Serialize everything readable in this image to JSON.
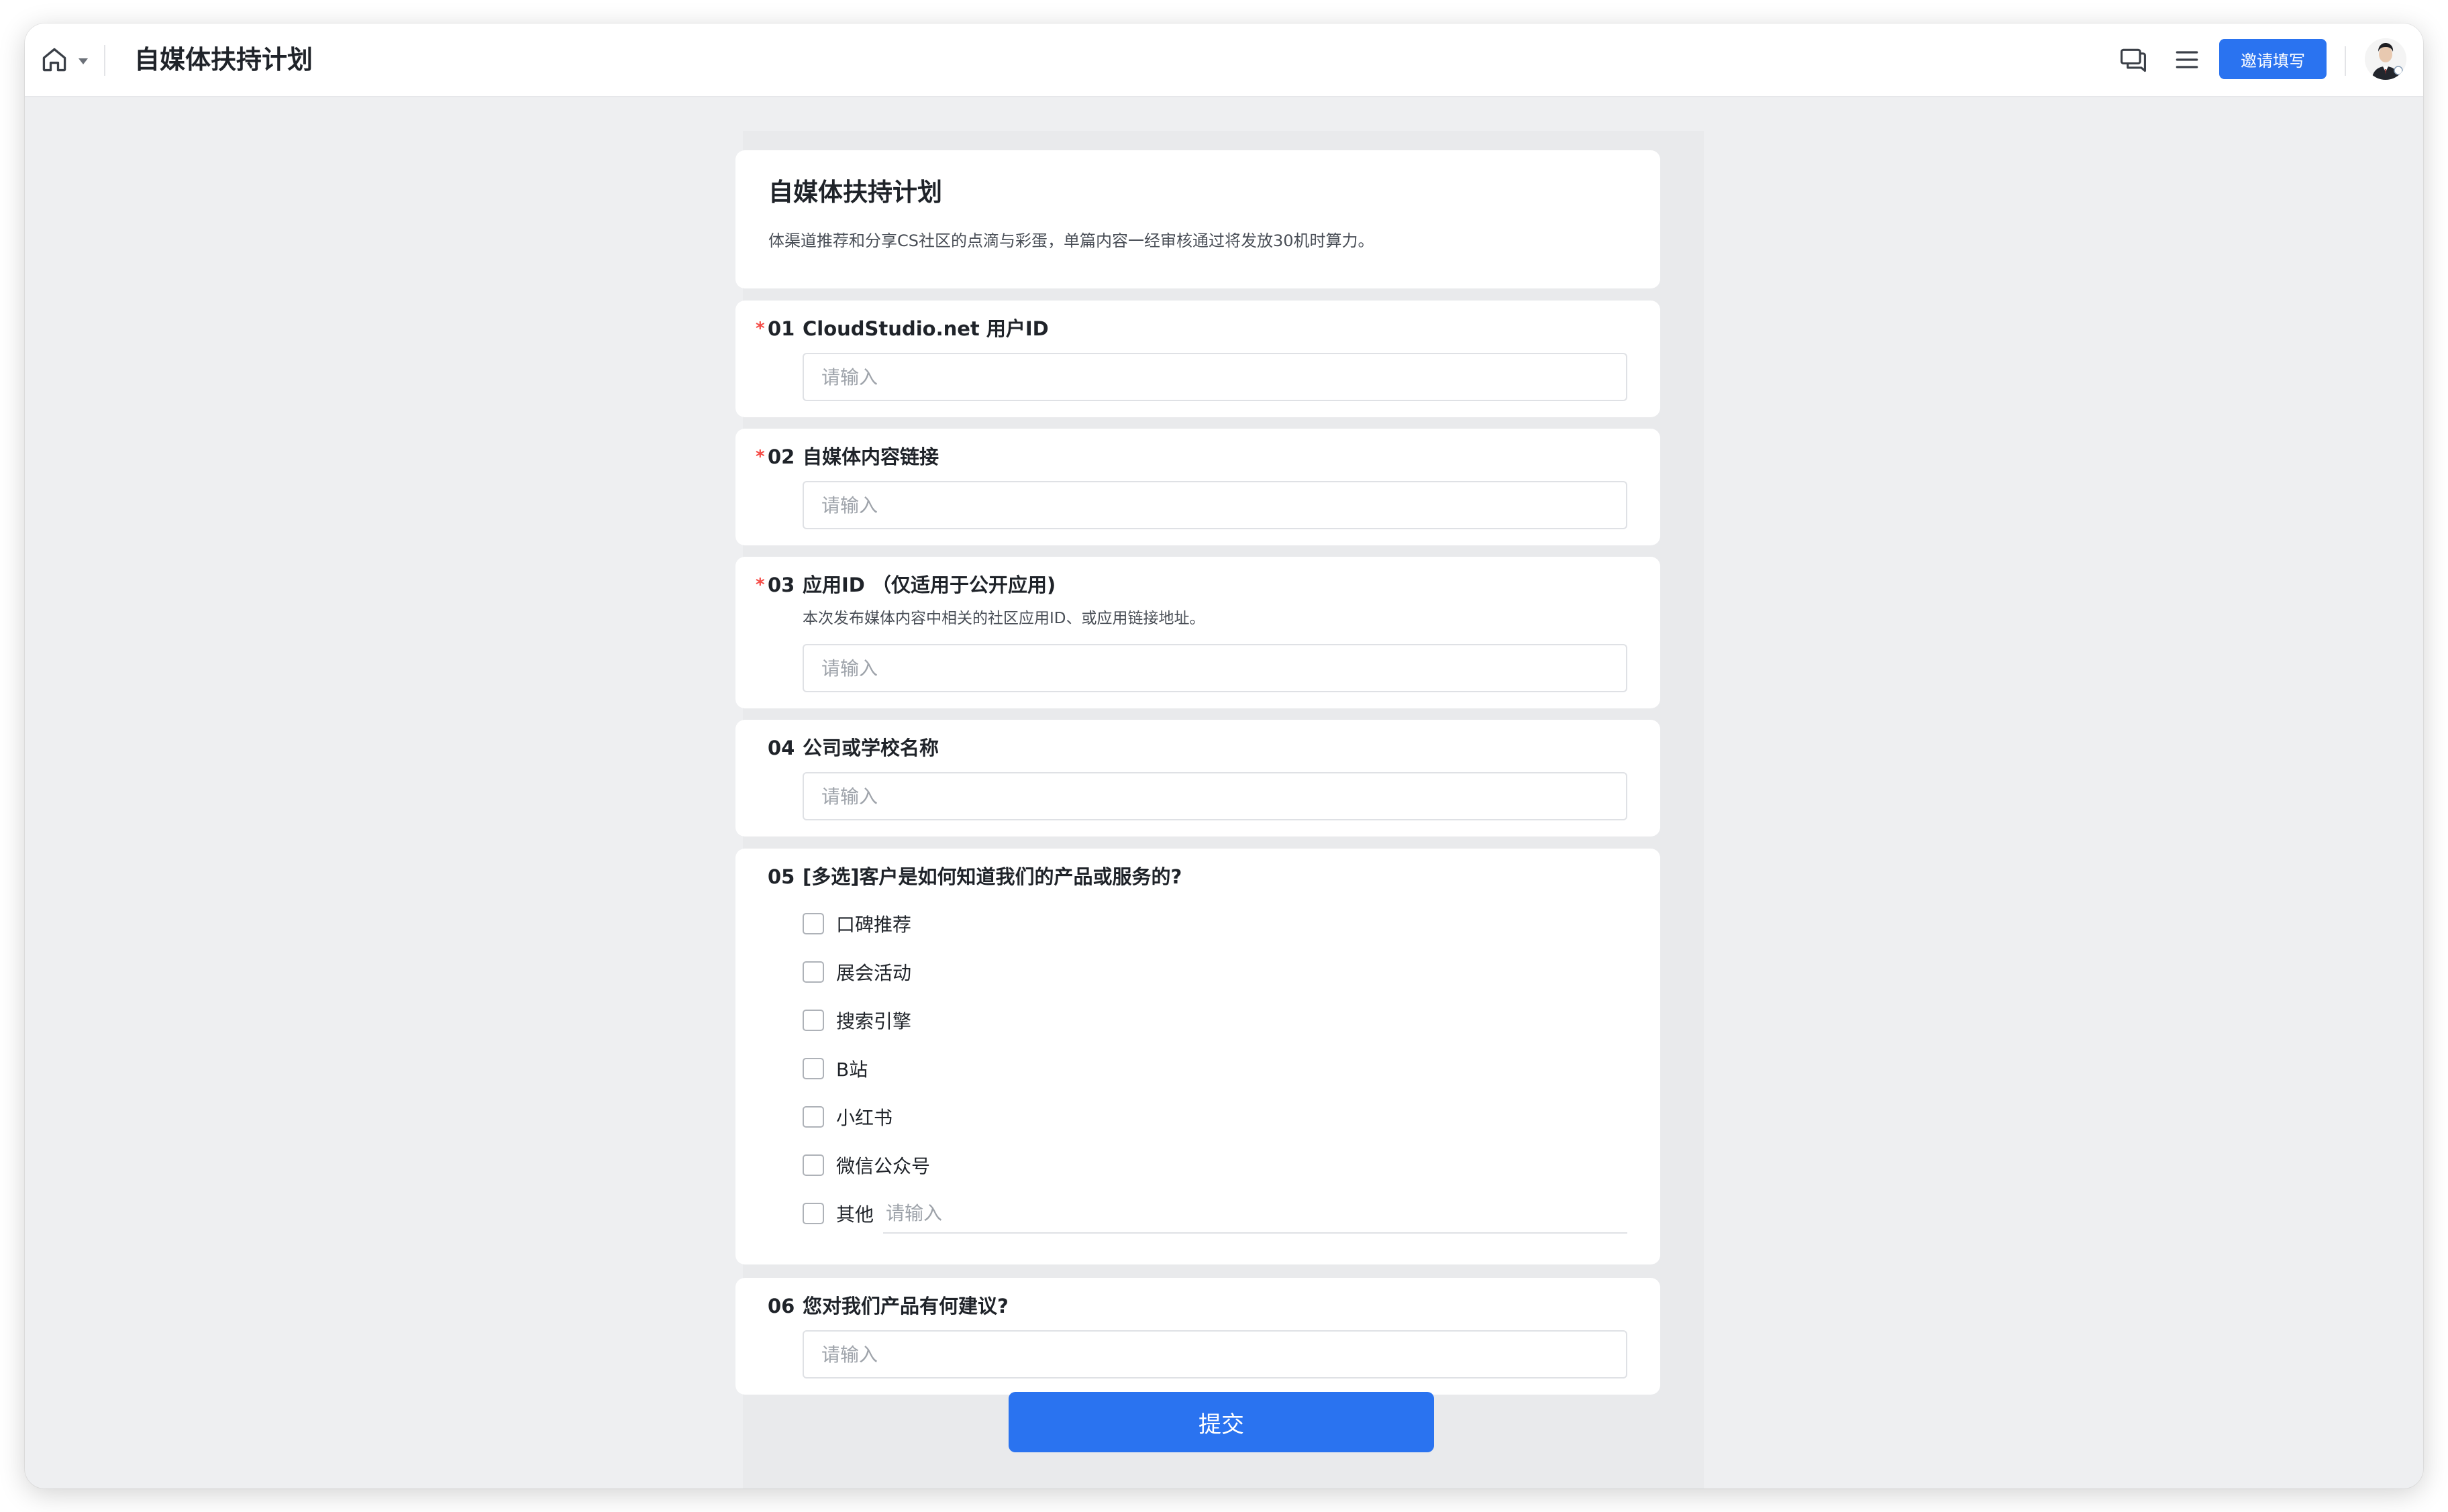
{
  "header": {
    "title": "自媒体扶持计划",
    "invite_label": "邀请填写",
    "icons": {
      "home": "home-icon",
      "chat": "chat-windows-icon",
      "menu": "menu-icon"
    },
    "accent": "#2a73f0"
  },
  "intro": {
    "title": "自媒体扶持计划",
    "description": "体渠道推荐和分享CS社区的点滴与彩蛋，单篇内容一经审核通过将发放30机时算力。"
  },
  "questions": [
    {
      "number": "01",
      "required": true,
      "label": "CloudStudio.net 用户ID",
      "placeholder": "请输入",
      "value": ""
    },
    {
      "number": "02",
      "required": true,
      "label": "自媒体内容链接",
      "placeholder": "请输入",
      "value": ""
    },
    {
      "number": "03",
      "required": true,
      "label": "应用ID （仅适用于公开应用)",
      "hint": "本次发布媒体内容中相关的社区应用ID、或应用链接地址。",
      "placeholder": "请输入",
      "value": ""
    },
    {
      "number": "04",
      "required": false,
      "label": "公司或学校名称",
      "placeholder": "请输入",
      "value": ""
    },
    {
      "number": "05",
      "required": false,
      "label": "[多选]客户是如何知道我们的产品或服务的?",
      "options": [
        "口碑推荐",
        "展会活动",
        "搜索引擎",
        "B站",
        "小红书",
        "微信公众号",
        "其他"
      ],
      "other_placeholder": "请输入"
    },
    {
      "number": "06",
      "required": false,
      "label": "您对我们产品有何建议?",
      "placeholder": "请输入",
      "value": ""
    }
  ],
  "required_mark": "*",
  "submit_label": "提交"
}
